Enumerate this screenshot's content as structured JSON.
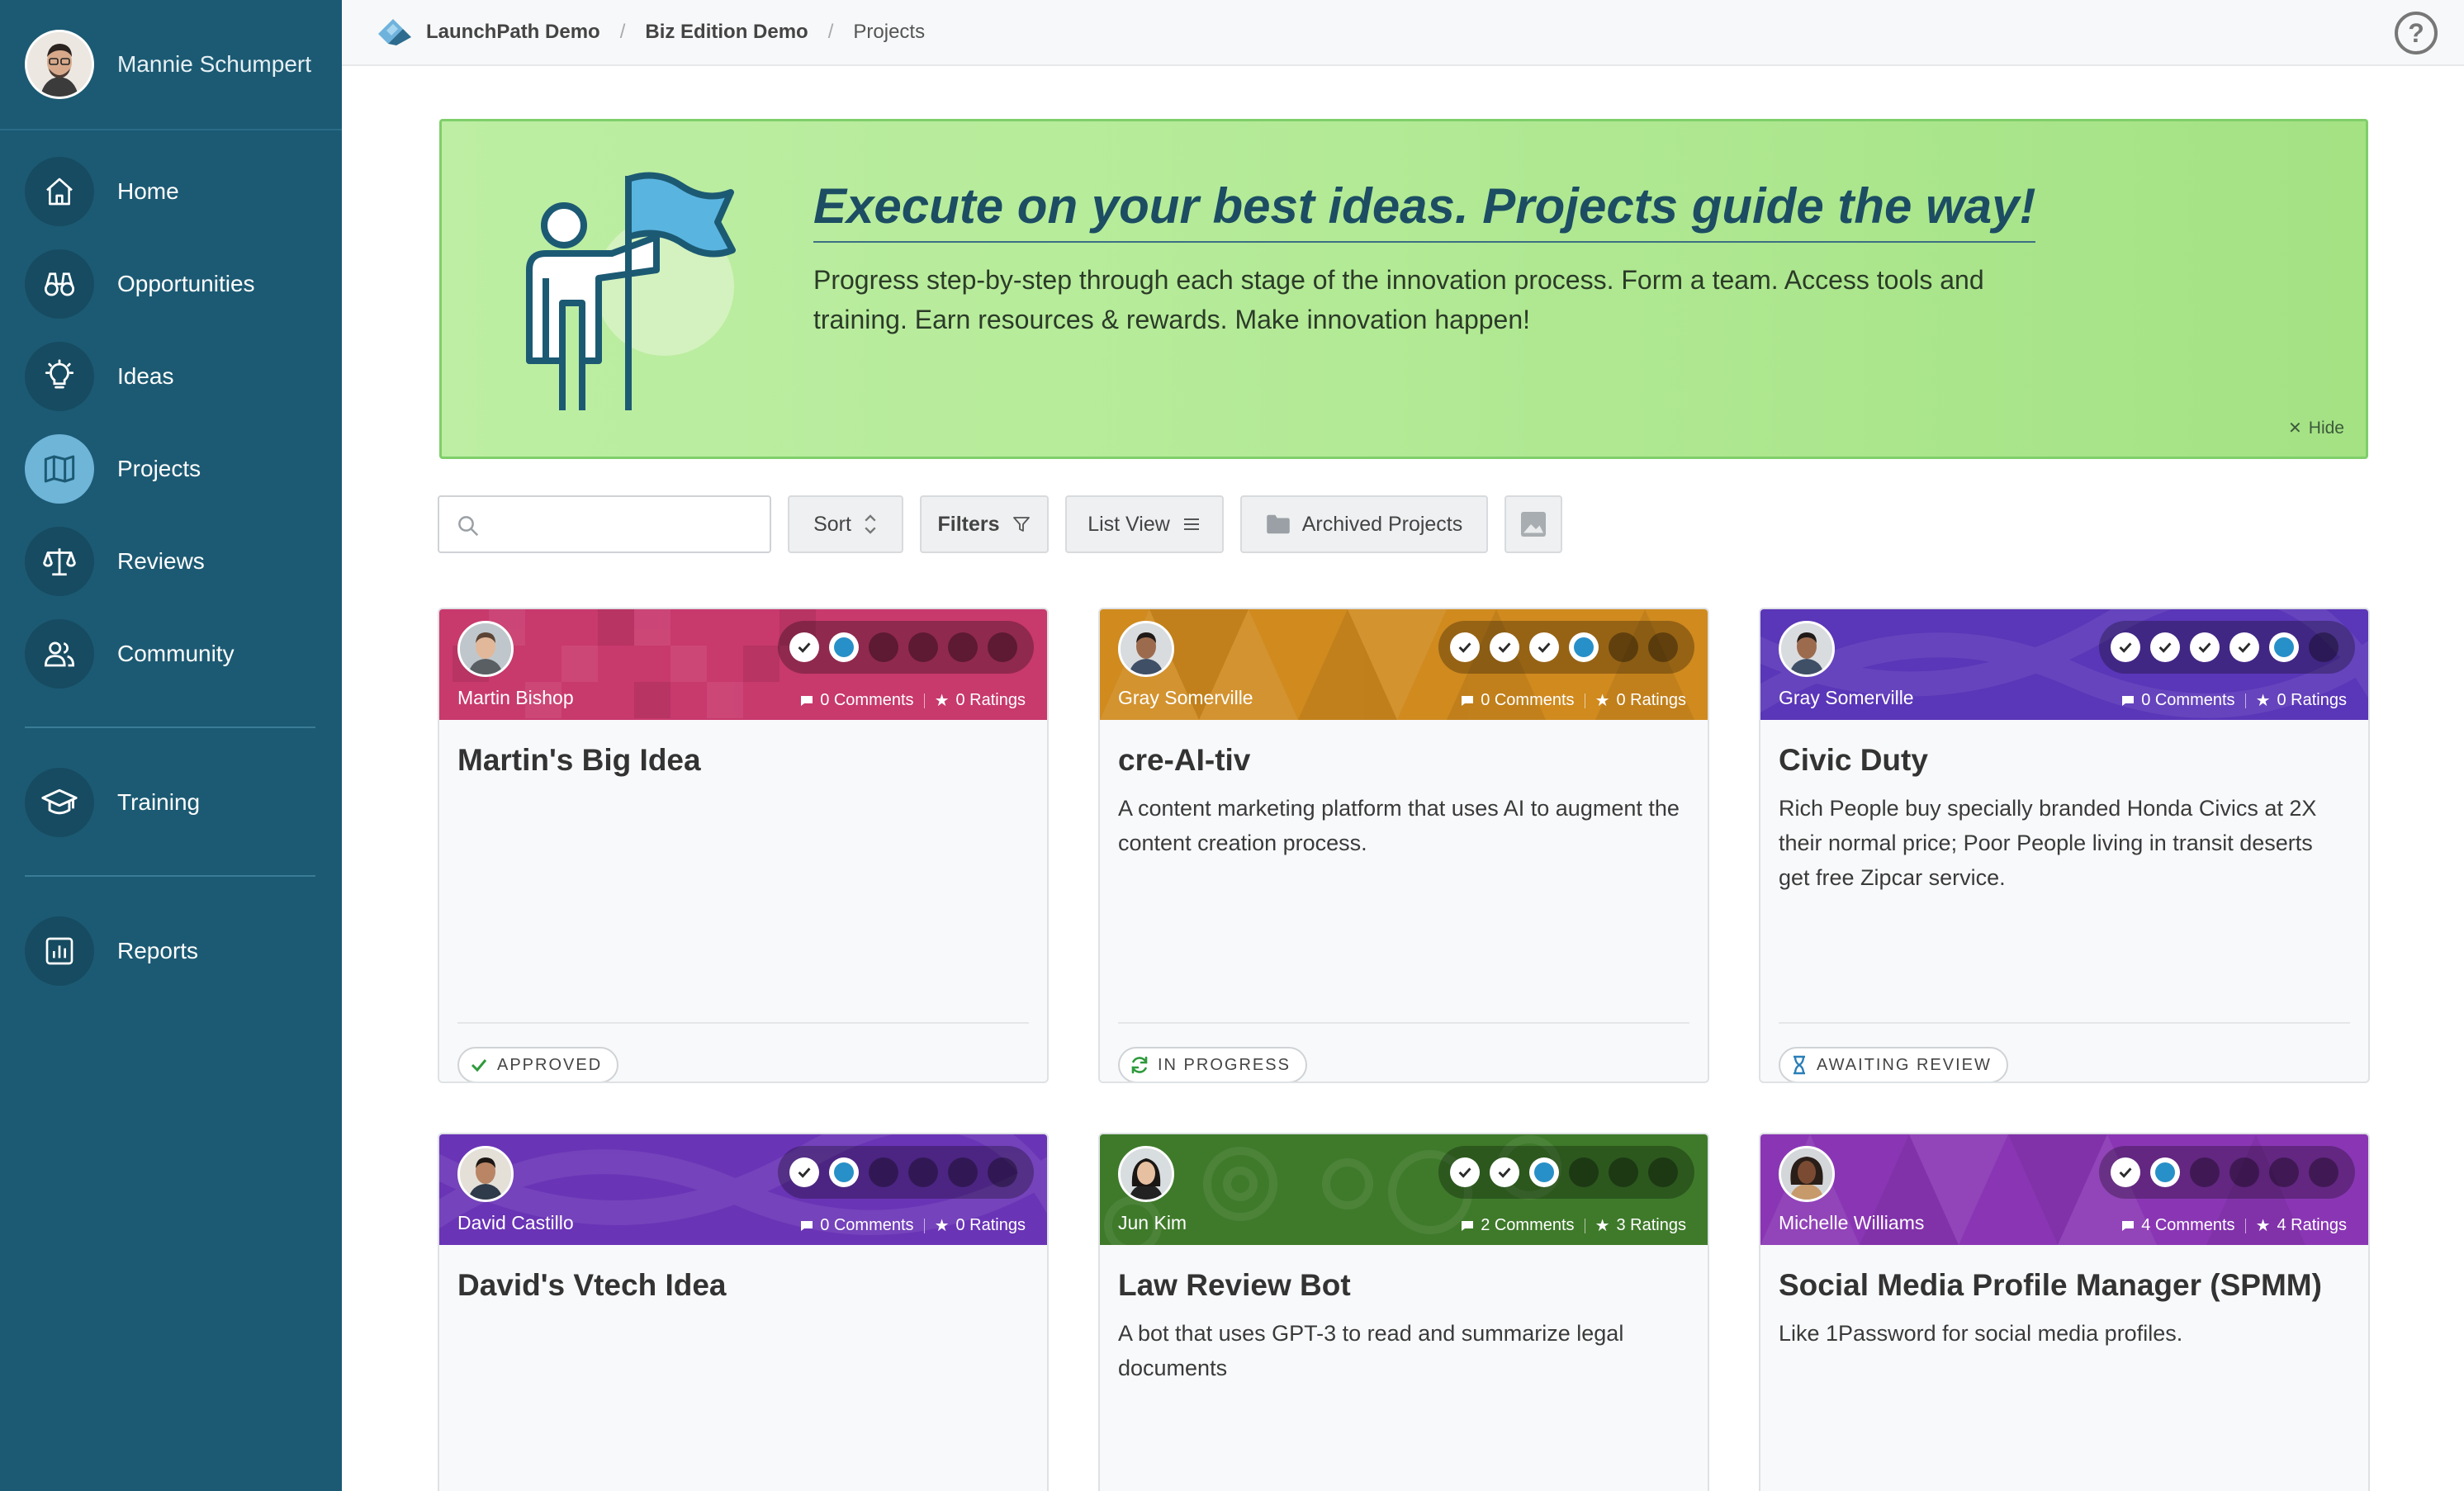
{
  "sidebar": {
    "user_name": "Mannie Schumpert",
    "nav": [
      {
        "label": "Home",
        "icon": "home-icon"
      },
      {
        "label": "Opportunities",
        "icon": "binoculars-icon"
      },
      {
        "label": "Ideas",
        "icon": "lightbulb-icon"
      },
      {
        "label": "Projects",
        "icon": "map-icon",
        "active": true
      },
      {
        "label": "Reviews",
        "icon": "scales-icon"
      },
      {
        "label": "Community",
        "icon": "users-icon"
      },
      {
        "label": "Training",
        "icon": "graduation-cap-icon"
      },
      {
        "label": "Reports",
        "icon": "bar-chart-icon"
      }
    ]
  },
  "topbar": {
    "breadcrumbs": [
      "LaunchPath Demo",
      "Biz Edition Demo",
      "Projects"
    ],
    "help": "?"
  },
  "banner": {
    "title": "Execute on your best ideas. Projects guide the way!",
    "body": "Progress step-by-step through each stage of the innovation process. Form a team. Access tools and training. Earn resources & rewards. Make innovation happen!",
    "hide_label": "Hide"
  },
  "toolbar": {
    "search_placeholder": "",
    "sort_label": "Sort",
    "filters_label": "Filters",
    "view_label": "List View",
    "archived_label": "Archived Projects"
  },
  "colors": {
    "sidebar": "#1c5a73",
    "banner": "#b5eb98",
    "accent": "#2890c8"
  },
  "cards": [
    {
      "owner": "Martin Bishop",
      "comments": "0 Comments",
      "ratings": "0 Ratings",
      "title": "Martin's Big Idea",
      "desc": "",
      "status": "APPROVED",
      "status_icon": "check-icon",
      "stages_done": 1,
      "stage_current": 2,
      "stages_total": 6,
      "color": "#c8396c"
    },
    {
      "owner": "Gray Somerville",
      "comments": "0 Comments",
      "ratings": "0 Ratings",
      "title": "cre-AI-tiv",
      "desc": "A content marketing platform that uses AI to augment the content creation process.",
      "status": "IN PROGRESS",
      "status_icon": "refresh-icon",
      "stages_done": 3,
      "stage_current": 4,
      "stages_total": 6,
      "color": "#d08a1e"
    },
    {
      "owner": "Gray Somerville",
      "comments": "0 Comments",
      "ratings": "0 Ratings",
      "title": "Civic Duty",
      "desc": "Rich People buy specially branded Honda Civics at 2X their normal price; Poor People living in transit deserts get free Zipcar service.",
      "status": "AWAITING REVIEW",
      "status_icon": "hourglass-icon",
      "stages_done": 4,
      "stage_current": 5,
      "stages_total": 6,
      "color": "#5a36b8"
    },
    {
      "owner": "David Castillo",
      "comments": "0 Comments",
      "ratings": "0 Ratings",
      "title": "David's Vtech Idea",
      "desc": "",
      "status": "",
      "status_icon": "",
      "stages_done": 1,
      "stage_current": 2,
      "stages_total": 6,
      "color": "#6a34b6"
    },
    {
      "owner": "Jun Kim",
      "comments": "2 Comments",
      "ratings": "3 Ratings",
      "title": "Law Review Bot",
      "desc": "A bot that uses GPT-3 to read and summarize legal documents",
      "status": "",
      "status_icon": "",
      "stages_done": 2,
      "stage_current": 3,
      "stages_total": 6,
      "color": "#3e7a2a"
    },
    {
      "owner": "Michelle Williams",
      "comments": "4 Comments",
      "ratings": "4 Ratings",
      "title": "Social Media Profile Manager (SPMM)",
      "desc": "Like 1Password for social media profiles.",
      "status": "",
      "status_icon": "",
      "stages_done": 1,
      "stage_current": 2,
      "stages_total": 6,
      "color": "#8a36b4"
    }
  ]
}
